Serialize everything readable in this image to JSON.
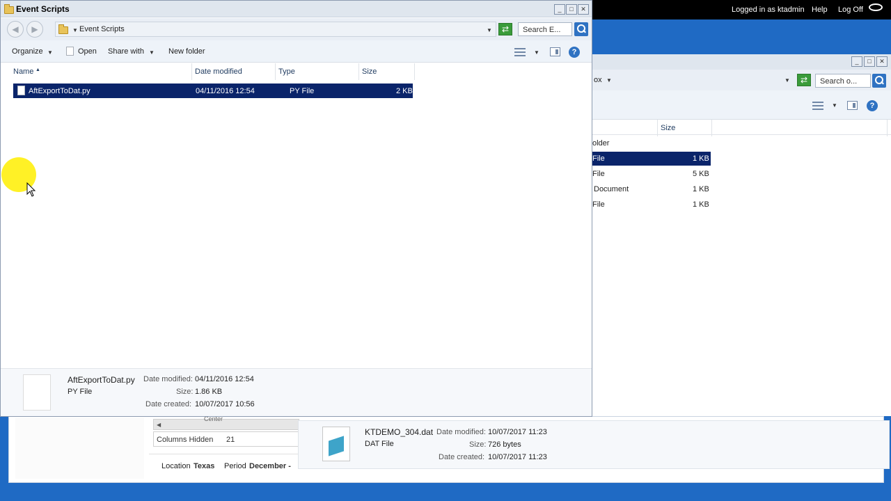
{
  "topbar": {
    "logged_in": "Logged in as ktadmin",
    "help": "Help",
    "logoff": "Log Off"
  },
  "background_app": {
    "grid_label": "Center",
    "columns_hidden_label": "Columns Hidden",
    "columns_hidden_value": "21",
    "location_label": "Location",
    "location_value": "Texas",
    "period_label": "Period",
    "period_value": "December -"
  },
  "explorer_back": {
    "address_fragment": "ox",
    "search_placeholder": "Search o...",
    "col_size": "Size",
    "rows": [
      {
        "type": "older",
        "size": ""
      },
      {
        "type": "File",
        "size": "1 KB",
        "selected": true
      },
      {
        "type": "File",
        "size": "5 KB"
      },
      {
        "type": "Document",
        "size": "1 KB"
      },
      {
        "type": "File",
        "size": "1 KB"
      }
    ]
  },
  "explorer": {
    "title": "Event Scripts",
    "address": "Event Scripts",
    "search_placeholder": "Search E...",
    "toolbar": {
      "organize": "Organize",
      "open": "Open",
      "share_with": "Share with",
      "new_folder": "New folder"
    },
    "columns": {
      "name": "Name",
      "date_modified": "Date modified",
      "type": "Type",
      "size": "Size"
    },
    "files": [
      {
        "name": "AftExportToDat.py",
        "date_modified": "04/11/2016 12:54",
        "type": "PY File",
        "size": "2 KB"
      }
    ],
    "details": {
      "filename": "AftExportToDat.py",
      "type": "PY File",
      "date_modified_label": "Date modified:",
      "date_modified": "04/11/2016 12:54",
      "size_label": "Size:",
      "size": "1.86 KB",
      "date_created_label": "Date created:",
      "date_created": "10/07/2017 10:56"
    }
  },
  "dat_details": {
    "filename": "KTDEMO_304.dat",
    "type": "DAT File",
    "date_modified_label": "Date modified:",
    "date_modified": "10/07/2017 11:23",
    "size_label": "Size:",
    "size": "726 bytes",
    "date_created_label": "Date created:",
    "date_created": "10/07/2017 11:23"
  },
  "colors": {
    "title_bar": "#dfe6ee",
    "selection": "#0a246a",
    "app_blue": "#1f6ac4",
    "cursor_highlight": "#ffee00"
  }
}
